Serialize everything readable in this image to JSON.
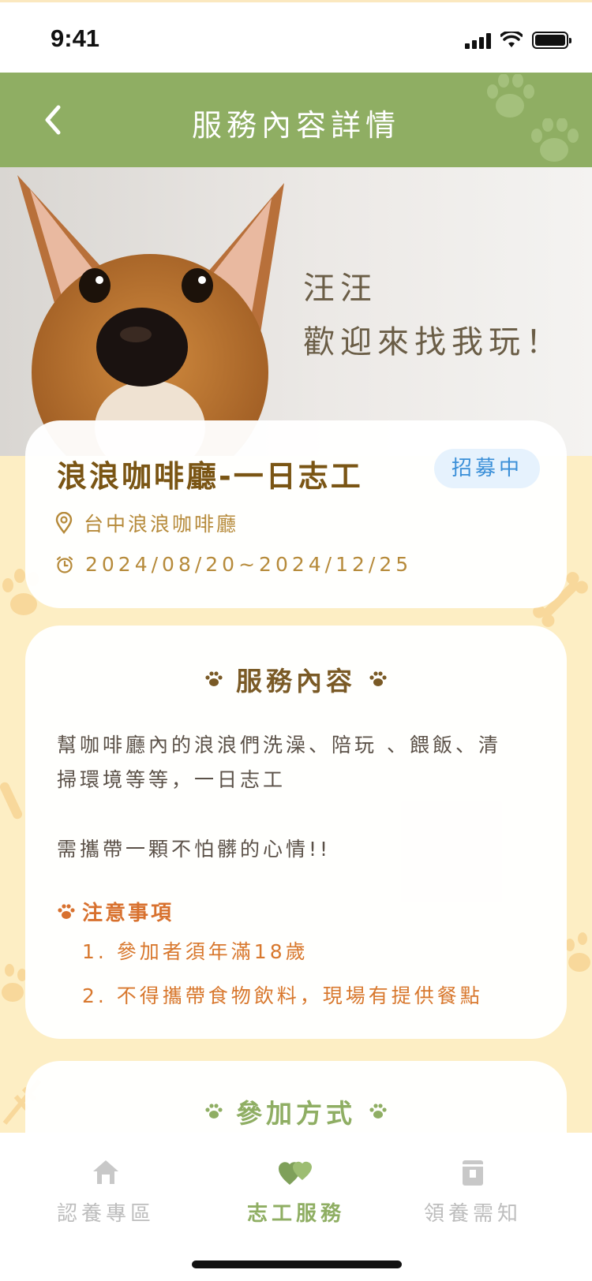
{
  "status_bar": {
    "time": "9:41"
  },
  "header": {
    "title": "服務內容詳情",
    "back_icon": "chevron-left-icon"
  },
  "hero": {
    "line1": "汪汪",
    "line2": "歡迎來找我玩！"
  },
  "info_card": {
    "title": "浪浪咖啡廳-一日志工",
    "status": "招募中",
    "location": "台中浪浪咖啡廳",
    "date_range": "2024/08/20~2024/12/25"
  },
  "detail_card": {
    "heading": "服務內容",
    "desc_line1": "幫咖啡廳內的浪浪們洗澡、陪玩 、餵飯、清",
    "desc_line2": "掃環境等等，一日志工",
    "desc_line3": "需攜帶一顆不怕髒的心情!!",
    "notes_heading": "注意事項",
    "notes": [
      "1. 參加者須年滿18歲",
      "2. 不得攜帶食物飲料，現場有提供餐點"
    ]
  },
  "join_card": {
    "heading": "參加方式"
  },
  "tab_bar": {
    "tabs": [
      {
        "label": "認養專區",
        "icon": "home-icon"
      },
      {
        "label": "志工服務",
        "icon": "hearts-icon"
      },
      {
        "label": "領養需知",
        "icon": "book-icon"
      }
    ],
    "active": "志工服務"
  },
  "colors": {
    "header_bg": "#8fae63",
    "page_bg": "#fdeec4",
    "title_brown": "#7a5514",
    "badge_blue": "#3a8fd8",
    "note_orange": "#d8712e",
    "tab_active": "#8fae63",
    "tab_inactive": "#bdbdbd"
  }
}
